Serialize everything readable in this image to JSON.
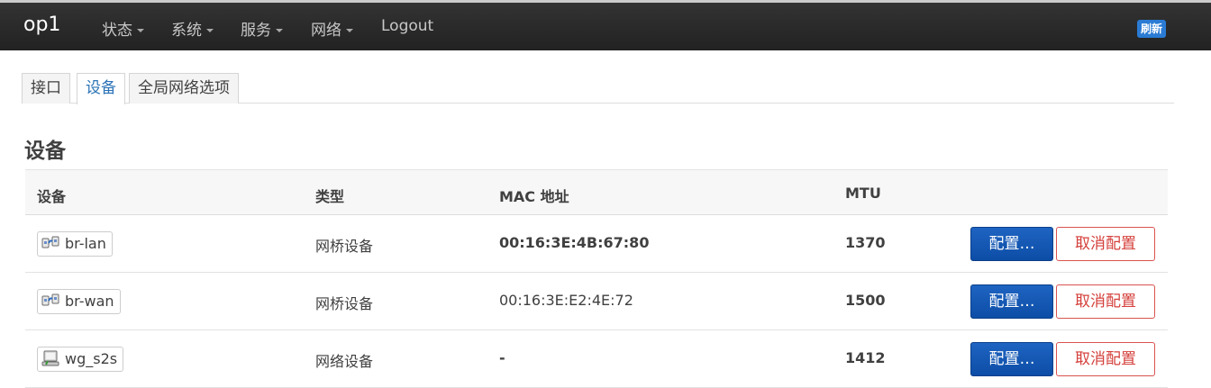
{
  "navbar": {
    "brand": "op1",
    "menu": [
      {
        "label": "状态",
        "has_caret": true
      },
      {
        "label": "系统",
        "has_caret": true
      },
      {
        "label": "服务",
        "has_caret": true
      },
      {
        "label": "网络",
        "has_caret": true
      },
      {
        "label": "Logout",
        "has_caret": false
      }
    ],
    "refresh_label": "刷新"
  },
  "tabs": [
    {
      "label": "接口",
      "active": false
    },
    {
      "label": "设备",
      "active": true
    },
    {
      "label": "全局网络选项",
      "active": false
    }
  ],
  "section_title": "设备",
  "table": {
    "headers": [
      "设备",
      "类型",
      "MAC 地址",
      "MTU"
    ],
    "rows": [
      {
        "device": "br-lan",
        "icon": "bridge-icon",
        "type": "网桥设备",
        "mac": "00:16:3E:4B:67:80",
        "mac_bold": true,
        "mtu": "1370",
        "config_label": "配置…",
        "unconfig_label": "取消配置"
      },
      {
        "device": "br-wan",
        "icon": "bridge-icon",
        "type": "网桥设备",
        "mac": "00:16:3E:E2:4E:72",
        "mac_bold": false,
        "mtu": "1500",
        "config_label": "配置…",
        "unconfig_label": "取消配置"
      },
      {
        "device": "wg_s2s",
        "icon": "network-device-icon",
        "type": "网络设备",
        "mac": "-",
        "mac_bold": true,
        "mtu": "1412",
        "config_label": "配置…",
        "unconfig_label": "取消配置"
      }
    ]
  },
  "colors": {
    "navbar_bg": "#222222",
    "active_tab": "#2b73b6",
    "primary_button": "#1a5db8",
    "danger": "#d43f3a",
    "refresh_badge": "#2a7bd4"
  }
}
